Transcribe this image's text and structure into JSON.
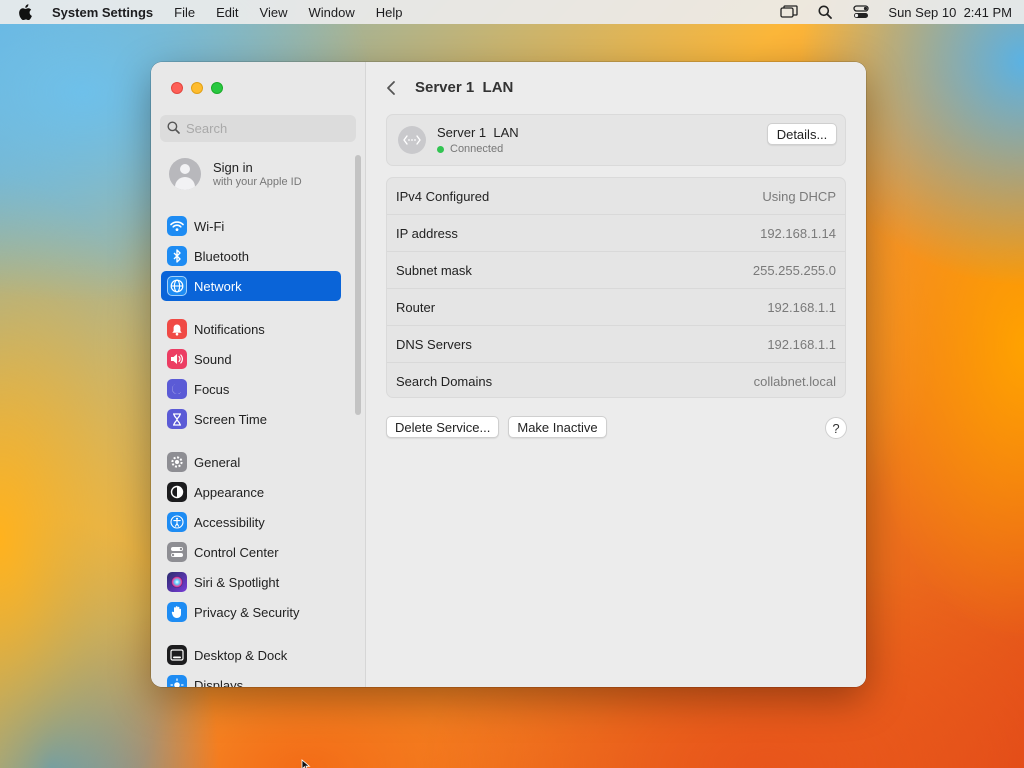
{
  "menubar": {
    "app_name": "System Settings",
    "menus": [
      "File",
      "Edit",
      "View",
      "Window",
      "Help"
    ],
    "clock": "Sun Sep 10  2:41 PM"
  },
  "sidebar": {
    "search_placeholder": "Search",
    "signin_title": "Sign in",
    "signin_subtitle": "with your Apple ID",
    "items": [
      {
        "label": "Wi-Fi",
        "icon": "wifi-icon",
        "color": "#1e8cf3"
      },
      {
        "label": "Bluetooth",
        "icon": "bluetooth-icon",
        "color": "#1e8cf3"
      },
      {
        "label": "Network",
        "icon": "globe-icon",
        "color": "#1e8cf3",
        "active": true
      },
      {
        "label": "Notifications",
        "icon": "bell-icon",
        "color": "#f04a45"
      },
      {
        "label": "Sound",
        "icon": "speaker-icon",
        "color": "#ec3d63"
      },
      {
        "label": "Focus",
        "icon": "moon-icon",
        "color": "#5b5bd6"
      },
      {
        "label": "Screen Time",
        "icon": "hourglass-icon",
        "color": "#5b5bd6"
      },
      {
        "label": "General",
        "icon": "gear-icon",
        "color": "#8e8e93"
      },
      {
        "label": "Appearance",
        "icon": "appearance-icon",
        "color": "#1c1c1e"
      },
      {
        "label": "Accessibility",
        "icon": "accessibility-icon",
        "color": "#1e8cf3"
      },
      {
        "label": "Control Center",
        "icon": "control-center-icon",
        "color": "#8e8e93"
      },
      {
        "label": "Siri & Spotlight",
        "icon": "siri-icon",
        "color": "#7a3cd9"
      },
      {
        "label": "Privacy & Security",
        "icon": "hand-icon",
        "color": "#1e8cf3"
      },
      {
        "label": "Desktop & Dock",
        "icon": "dock-icon",
        "color": "#1c1c1e"
      },
      {
        "label": "Displays",
        "icon": "sun-icon",
        "color": "#1e8cf3"
      }
    ]
  },
  "main": {
    "title": "Server 1  LAN",
    "service_name": "Server 1  LAN",
    "service_status": "Connected",
    "details_label": "Details...",
    "rows": [
      {
        "label": "IPv4 Configured",
        "value": "Using DHCP"
      },
      {
        "label": "IP address",
        "value": "192.168.1.14"
      },
      {
        "label": "Subnet mask",
        "value": "255.255.255.0"
      },
      {
        "label": "Router",
        "value": "192.168.1.1"
      },
      {
        "label": "DNS Servers",
        "value": "192.168.1.1"
      },
      {
        "label": "Search Domains",
        "value": "collabnet.local"
      }
    ],
    "delete_label": "Delete Service...",
    "inactive_label": "Make Inactive",
    "help_label": "?"
  }
}
